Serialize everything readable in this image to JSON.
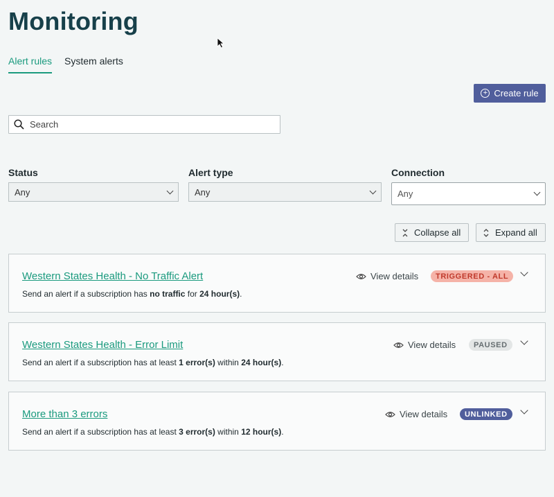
{
  "page": {
    "title": "Monitoring"
  },
  "tabs": [
    {
      "label": "Alert rules",
      "active": true
    },
    {
      "label": "System alerts",
      "active": false
    }
  ],
  "actions": {
    "create_rule_label": "Create rule"
  },
  "search": {
    "placeholder": "Search"
  },
  "filters": {
    "status": {
      "label": "Status",
      "value": "Any"
    },
    "alert_type": {
      "label": "Alert type",
      "value": "Any"
    },
    "connection": {
      "label": "Connection",
      "value": "Any"
    }
  },
  "toolbar": {
    "collapse_label": "Collapse all",
    "expand_label": "Expand all"
  },
  "rules": [
    {
      "title": "Western States Health - No Traffic Alert",
      "view_label": "View details",
      "status": "TRIGGERED - ALL",
      "status_color": "#f5b3a8",
      "status_text_color": "#c0392b",
      "desc_1": "Send an alert if a subscription has ",
      "desc_b1": "no traffic",
      "desc_2": " for ",
      "desc_b2": "24 hour(s)",
      "desc_3": ".",
      "desc_b3": "",
      "desc_4": ""
    },
    {
      "title": "Western States Health - Error Limit",
      "view_label": "View details",
      "status": "PAUSED",
      "status_color": "#e3e6e6",
      "status_text_color": "#666e71",
      "desc_1": "Send an alert if a subscription has at least ",
      "desc_b1": "1 error(s)",
      "desc_2": " within ",
      "desc_b2": "24 hour(s)",
      "desc_3": ".",
      "desc_b3": "",
      "desc_4": ""
    },
    {
      "title": "More than 3 errors",
      "view_label": "View details",
      "status": "UNLINKED",
      "status_color": "#505e9c",
      "status_text_color": "#ffffff",
      "desc_1": "Send an alert if a subscription has at least ",
      "desc_b1": "3 error(s)",
      "desc_2": " within ",
      "desc_b2": "12 hour(s)",
      "desc_3": ".",
      "desc_b3": "",
      "desc_4": ""
    }
  ],
  "colors": {
    "accent": "#1a9a7e",
    "primary_button": "#505e9c",
    "title": "#17404a"
  },
  "icons": [
    "mouse-cursor-icon",
    "plus-circle-icon",
    "search-icon",
    "chevron-down-icon",
    "collapse-icon",
    "expand-icon",
    "eye-icon"
  ]
}
